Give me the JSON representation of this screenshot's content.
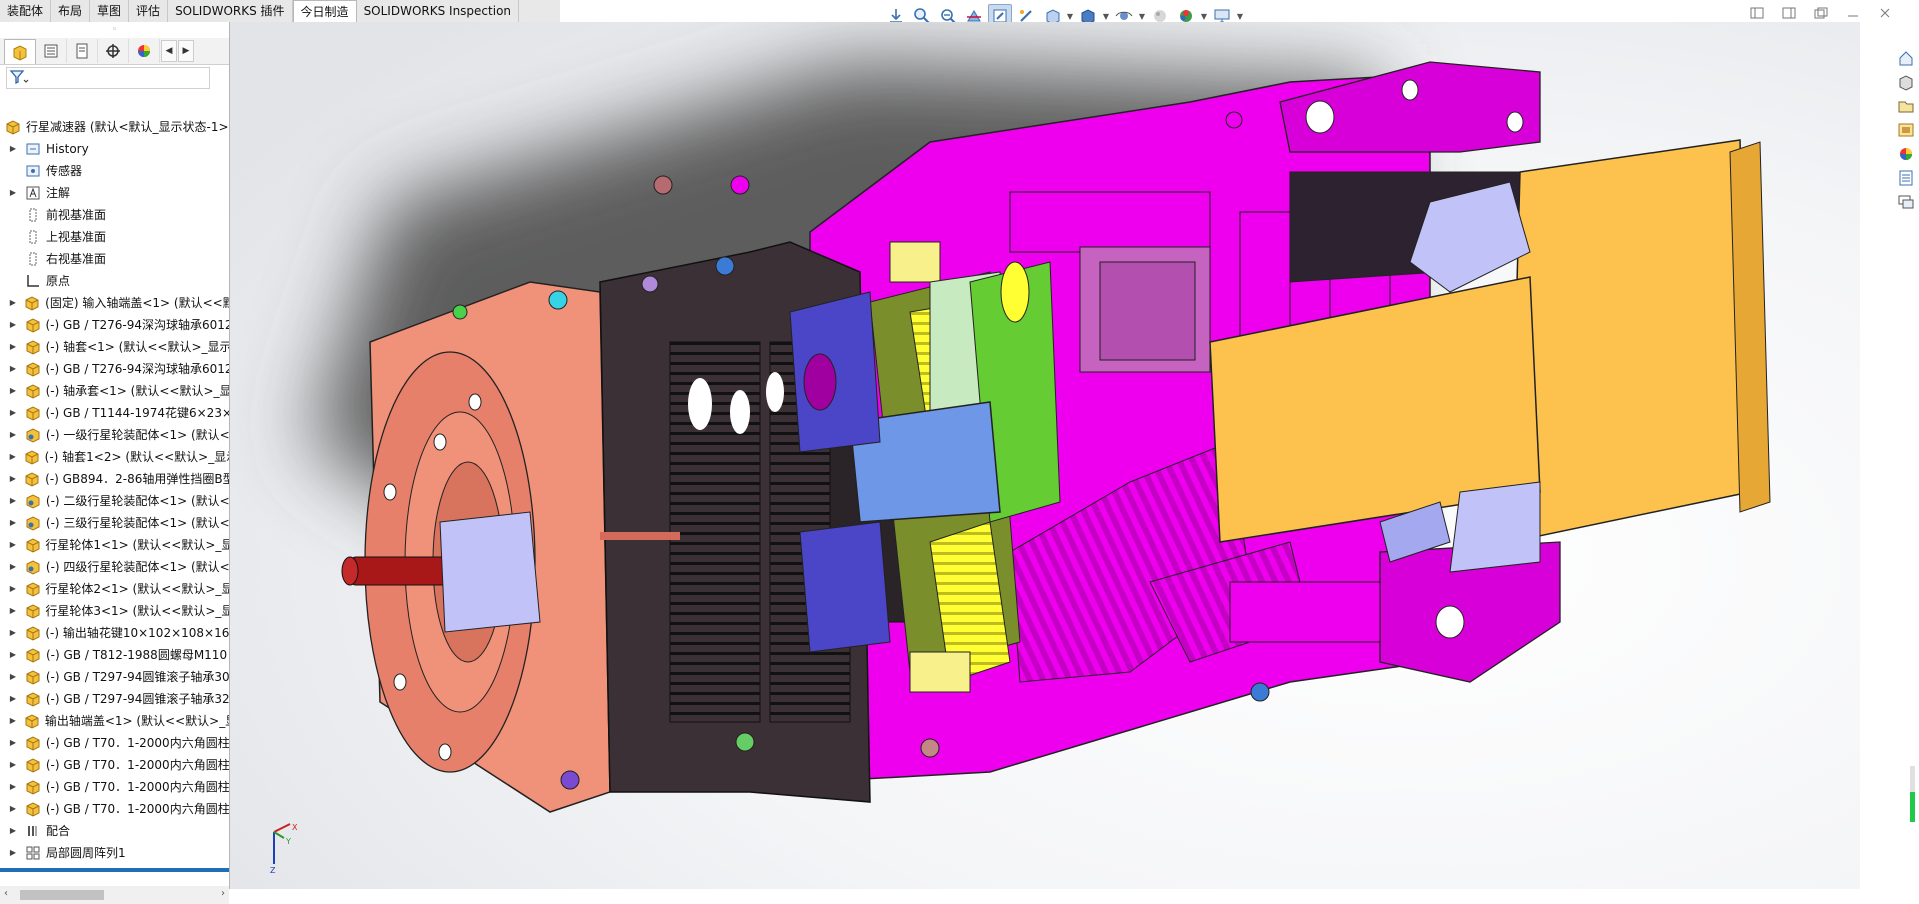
{
  "command_tabs": [
    {
      "label": "装配体",
      "active": false
    },
    {
      "label": "布局",
      "active": false
    },
    {
      "label": "草图",
      "active": false
    },
    {
      "label": "评估",
      "active": false
    },
    {
      "label": "SOLIDWORKS 插件",
      "active": false
    },
    {
      "label": "今日制造",
      "active": true
    },
    {
      "label": "SOLIDWORKS Inspection",
      "active": false
    }
  ],
  "panel": {
    "tabs": [
      "feature-manager",
      "property-manager",
      "configuration-manager",
      "dimxpert-manager",
      "display-manager"
    ],
    "filter_placeholder": ""
  },
  "tree": {
    "root": "行星减速器  (默认<默认_显示状态-1>",
    "items": [
      {
        "label": "History",
        "icon": "history-icon",
        "expand": true
      },
      {
        "label": "传感器",
        "icon": "sensor-icon",
        "expand": false
      },
      {
        "label": "注解",
        "icon": "annotation-icon",
        "expand": true
      },
      {
        "label": "前视基准面",
        "icon": "plane-icon",
        "expand": false
      },
      {
        "label": "上视基准面",
        "icon": "plane-icon",
        "expand": false
      },
      {
        "label": "右视基准面",
        "icon": "plane-icon",
        "expand": false
      },
      {
        "label": "原点",
        "icon": "origin-icon",
        "expand": false
      },
      {
        "label": "(固定) 输入轴端盖<1> (默认<<默",
        "icon": "part-icon",
        "expand": true
      },
      {
        "label": "(-) GB / T276-94深沟球轴承6012",
        "icon": "part-icon",
        "expand": true
      },
      {
        "label": "(-) 轴套<1> (默认<<默认>_显示",
        "icon": "part-icon",
        "expand": true
      },
      {
        "label": "(-) GB / T276-94深沟球轴承6012",
        "icon": "part-icon",
        "expand": true
      },
      {
        "label": "(-) 轴承套<1> (默认<<默认>_显",
        "icon": "part-icon",
        "expand": true
      },
      {
        "label": "(-) GB / T1144-1974花键6×23×",
        "icon": "part-icon",
        "expand": true
      },
      {
        "label": "(-) 一级行星轮装配体<1> (默认<",
        "icon": "subassembly-icon",
        "expand": true
      },
      {
        "label": "(-) 轴套1<2> (默认<<默认>_显示",
        "icon": "part-icon",
        "expand": true
      },
      {
        "label": "(-) GB894．2-86轴用弹性挡圈B型",
        "icon": "part-icon",
        "expand": true
      },
      {
        "label": "(-) 二级行星轮装配体<1> (默认<",
        "icon": "subassembly-icon",
        "expand": true
      },
      {
        "label": "(-) 三级行星轮装配体<1> (默认<",
        "icon": "subassembly-icon",
        "expand": true
      },
      {
        "label": "行星轮体1<1> (默认<<默认>_显",
        "icon": "part-icon",
        "expand": true
      },
      {
        "label": "(-) 四级行星轮装配体<1> (默认<",
        "icon": "subassembly-icon",
        "expand": true
      },
      {
        "label": "行星轮体2<1> (默认<<默认>_显",
        "icon": "part-icon",
        "expand": true
      },
      {
        "label": "行星轮体3<1> (默认<<默认>_显",
        "icon": "part-icon",
        "expand": true
      },
      {
        "label": "(-) 输出轴花键10×102×108×16:",
        "icon": "part-icon",
        "expand": true
      },
      {
        "label": "(-) GB / T812-1988圆螺母M110",
        "icon": "part-icon",
        "expand": true
      },
      {
        "label": "(-) GB / T297-94圆锥滚子轴承30",
        "icon": "part-icon",
        "expand": true
      },
      {
        "label": "(-) GB / T297-94圆锥滚子轴承32",
        "icon": "part-icon",
        "expand": true
      },
      {
        "label": "输出轴端盖<1> (默认<<默认>_显",
        "icon": "part-icon",
        "expand": true
      },
      {
        "label": "(-) GB / T70．1-2000内六角圆柱",
        "icon": "part-icon",
        "expand": true
      },
      {
        "label": "(-) GB / T70．1-2000内六角圆柱",
        "icon": "part-icon",
        "expand": true
      },
      {
        "label": "(-) GB / T70．1-2000内六角圆柱",
        "icon": "part-icon",
        "expand": true
      },
      {
        "label": "(-) GB / T70．1-2000内六角圆柱",
        "icon": "part-icon",
        "expand": true
      },
      {
        "label": "配合",
        "icon": "mate-icon",
        "expand": true
      },
      {
        "label": "局部圆周阵列1",
        "icon": "pattern-icon",
        "expand": true
      }
    ]
  },
  "triad": {
    "x": "X",
    "y": "Y",
    "z": "Z"
  },
  "colors": {
    "magenta": "#ee00ee",
    "orange": "#fdc24e",
    "salmon": "#f0917a",
    "blue": "#6f97e8",
    "yellow": "#ffff33",
    "green": "#66cc33",
    "lilac": "#c0c2f8"
  }
}
